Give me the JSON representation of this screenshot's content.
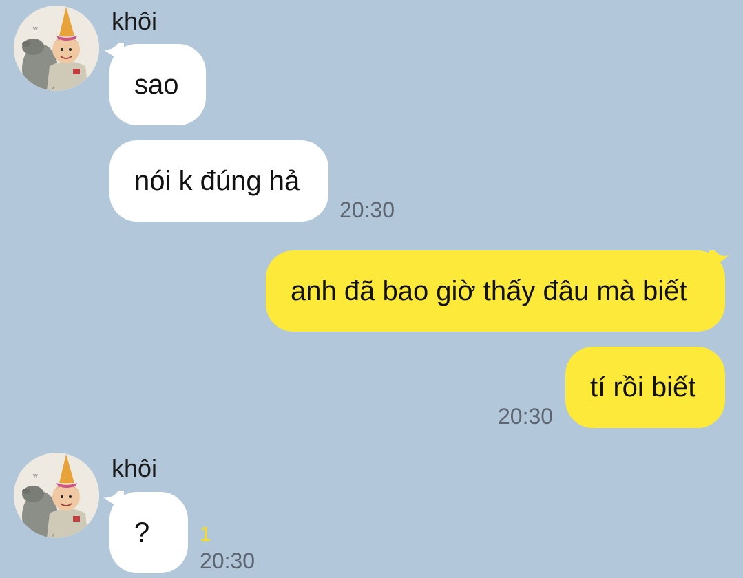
{
  "colors": {
    "background": "#b2c7da",
    "incoming_bubble": "#ffffff",
    "outgoing_bubble": "#fde93a",
    "timestamp": "#5d6670",
    "unread_count": "#f2dc24"
  },
  "messages": [
    {
      "direction": "incoming",
      "sender": "khôi",
      "text": "sao"
    },
    {
      "direction": "incoming",
      "text": "nói k đúng hả",
      "time": "20:30"
    },
    {
      "direction": "outgoing",
      "text": "anh đã bao giờ thấy đâu mà biết"
    },
    {
      "direction": "outgoing",
      "text": "tí rồi biết",
      "time": "20:30"
    },
    {
      "direction": "incoming",
      "sender": "khôi",
      "text": "?",
      "unread": "1",
      "time": "20:30"
    }
  ],
  "icons": {
    "avatar": "profile-photo-child-party-hat"
  }
}
